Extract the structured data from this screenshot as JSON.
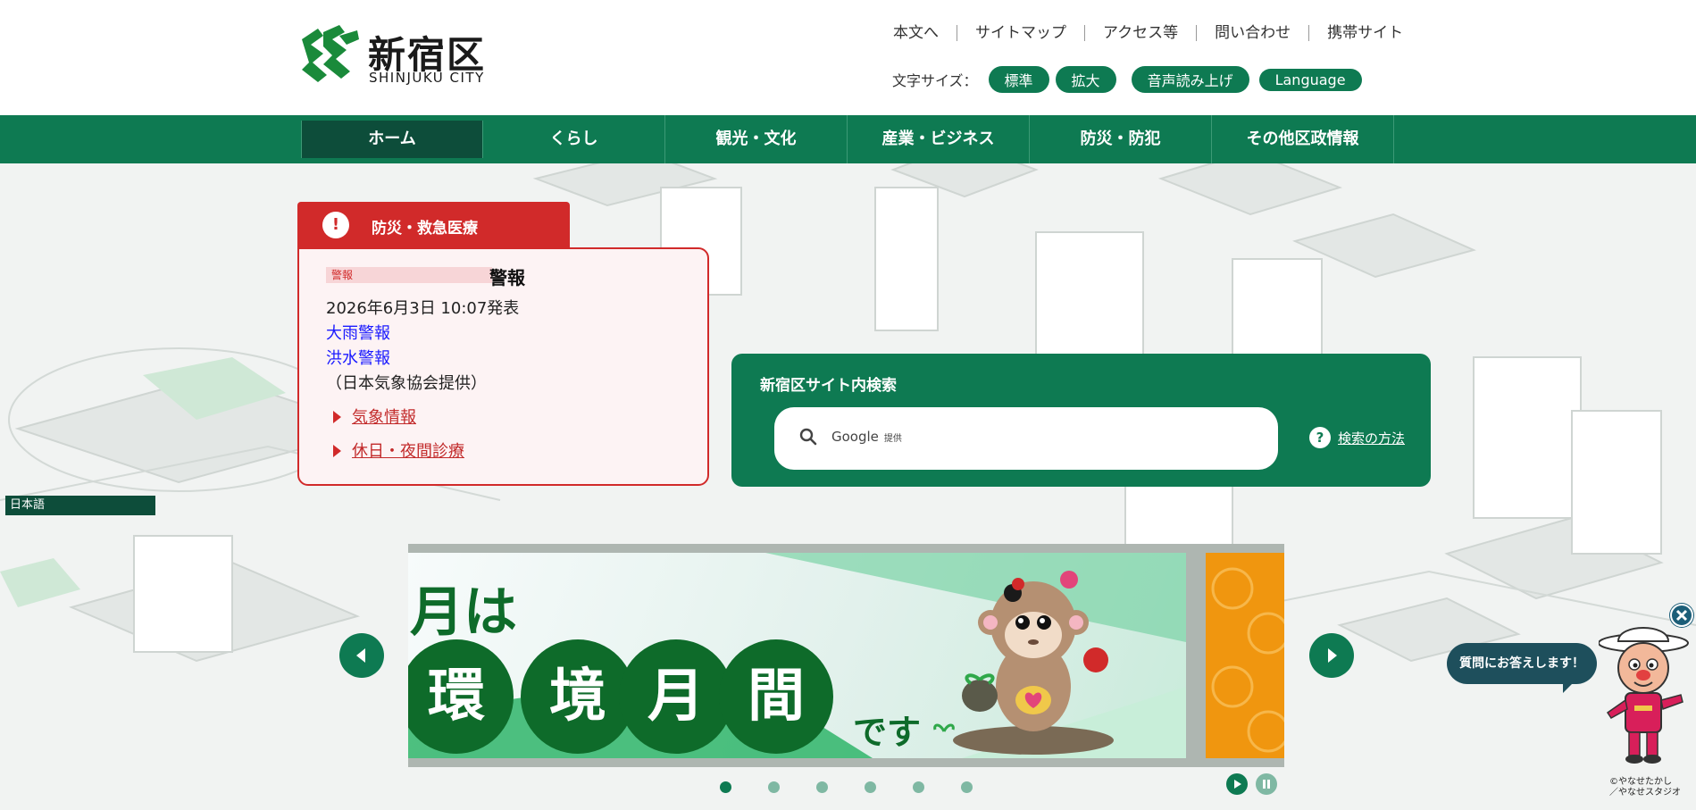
{
  "header": {
    "logo_kanji": "新宿区",
    "logo_roman": "SHINJUKU CITY",
    "top_links": [
      "本文へ",
      "サイトマップ",
      "アクセス等",
      "問い合わせ",
      "携帯サイト"
    ],
    "font_size_label": "文字サイズ：",
    "font_buttons": [
      "標準",
      "拡大"
    ],
    "speech_button": "音声読み上げ",
    "language_button": "Language"
  },
  "nav": {
    "items": [
      "ホーム",
      "くらし",
      "観光・文化",
      "産業・ビジネス",
      "防災・防犯",
      "その他区政情報"
    ],
    "active_index": 0
  },
  "alert": {
    "tab_title": "防災・救急医療",
    "tag": "警報",
    "title": "警報",
    "issued": "2026年6月3日 10:07発表",
    "warnings": [
      "大雨警報",
      "洪水警報"
    ],
    "provider": "（日本気象協会提供）",
    "links": [
      "気象情報",
      "休日・夜間診療"
    ]
  },
  "search": {
    "title": "新宿区サイト内検索",
    "placeholder": "Google",
    "placeholder_suffix": "提供",
    "help_label": "検索の方法"
  },
  "language_select": {
    "selected": "日本語"
  },
  "banner": {
    "line1": "月は",
    "circles": [
      "環",
      "境",
      "月",
      "間"
    ],
    "suffix": "です",
    "slide_count": 6,
    "active_slide": 0
  },
  "chat": {
    "bubble": "質問にお答えします！",
    "copyright_line1": "©やなせたかし",
    "copyright_line2": "／やなせスタジオ"
  },
  "colors": {
    "brand_green": "#0e7a52",
    "dark_green": "#0d4d3a",
    "alert_red": "#d12a2a",
    "banner_green": "#0e6b2a"
  }
}
